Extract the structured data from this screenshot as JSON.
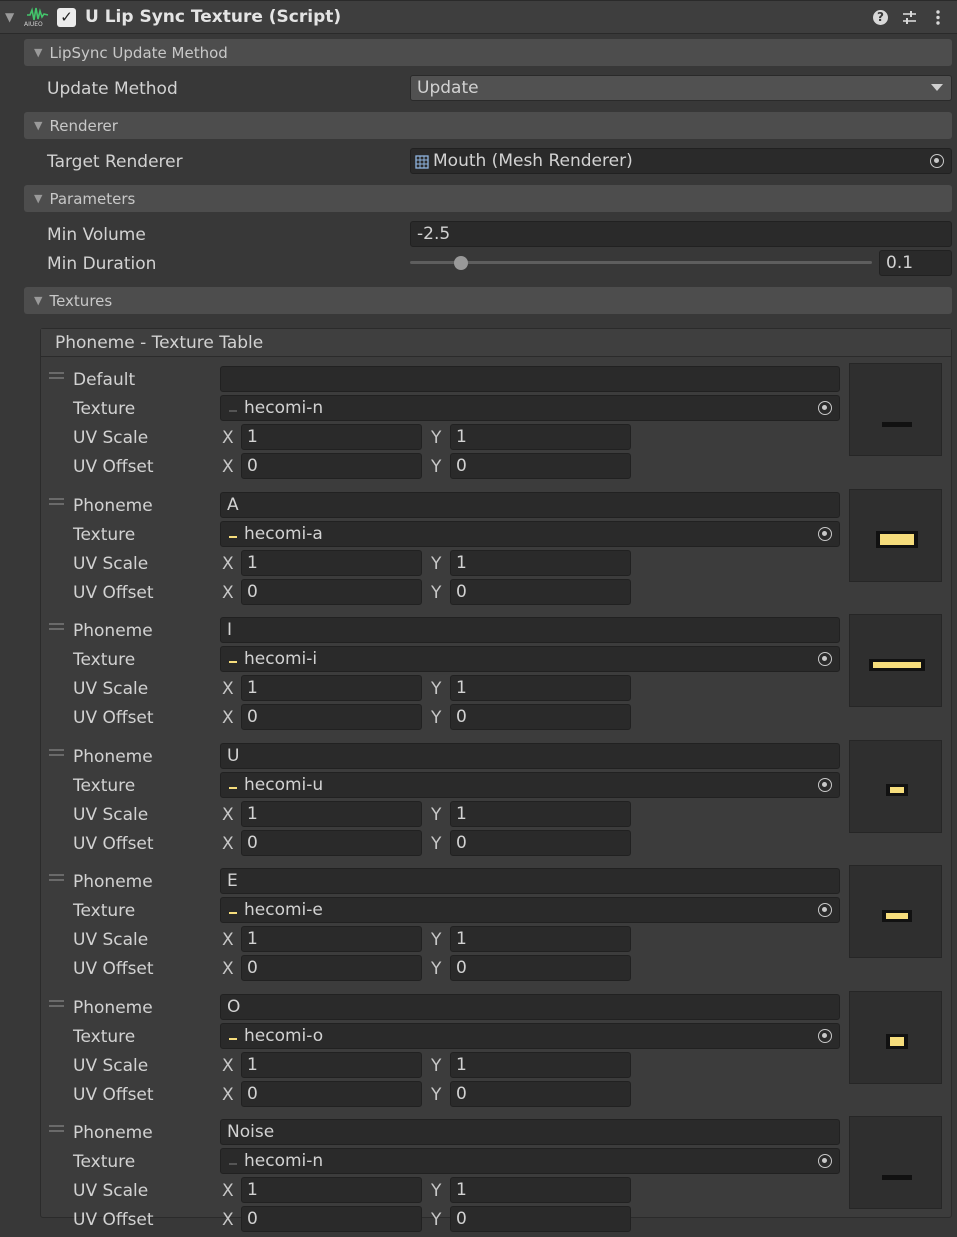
{
  "component": {
    "title": "U Lip Sync Texture (Script)",
    "enabled": true,
    "icon_text": "AIUEO"
  },
  "sections": {
    "update_method": {
      "title": "LipSync Update Method",
      "field_label": "Update Method",
      "value": "Update"
    },
    "renderer": {
      "title": "Renderer",
      "field_label": "Target Renderer",
      "value": "Mouth (Mesh Renderer)"
    },
    "parameters": {
      "title": "Parameters",
      "min_volume_label": "Min Volume",
      "min_volume": "-2.5",
      "min_duration_label": "Min Duration",
      "min_duration": "0.1",
      "min_duration_fraction": 0.11
    },
    "textures": {
      "title": "Textures",
      "table_title": "Phoneme - Texture Table"
    }
  },
  "row_labels": {
    "texture": "Texture",
    "uv_scale": "UV Scale",
    "uv_offset": "UV Offset",
    "x": "X",
    "y": "Y"
  },
  "entries": [
    {
      "label": "Default",
      "phoneme": "",
      "texture": "hecomi-n",
      "scale_x": "1",
      "scale_y": "1",
      "offset_x": "0",
      "offset_y": "0",
      "mouth": "n"
    },
    {
      "label": "Phoneme",
      "phoneme": "A",
      "texture": "hecomi-a",
      "scale_x": "1",
      "scale_y": "1",
      "offset_x": "0",
      "offset_y": "0",
      "mouth": "a"
    },
    {
      "label": "Phoneme",
      "phoneme": "I",
      "texture": "hecomi-i",
      "scale_x": "1",
      "scale_y": "1",
      "offset_x": "0",
      "offset_y": "0",
      "mouth": "i"
    },
    {
      "label": "Phoneme",
      "phoneme": "U",
      "texture": "hecomi-u",
      "scale_x": "1",
      "scale_y": "1",
      "offset_x": "0",
      "offset_y": "0",
      "mouth": "u"
    },
    {
      "label": "Phoneme",
      "phoneme": "E",
      "texture": "hecomi-e",
      "scale_x": "1",
      "scale_y": "1",
      "offset_x": "0",
      "offset_y": "0",
      "mouth": "e"
    },
    {
      "label": "Phoneme",
      "phoneme": "O",
      "texture": "hecomi-o",
      "scale_x": "1",
      "scale_y": "1",
      "offset_x": "0",
      "offset_y": "0",
      "mouth": "o"
    },
    {
      "label": "Phoneme",
      "phoneme": "Noise",
      "texture": "hecomi-n",
      "scale_x": "1",
      "scale_y": "1",
      "offset_x": "0",
      "offset_y": "0",
      "mouth": "n"
    }
  ],
  "icons": {
    "help": "help-icon",
    "presets": "presets-icon",
    "more": "kebab-menu-icon",
    "dropdown": "dropdown-arrow-icon",
    "object_picker": "object-picker-icon",
    "mesh_renderer": "mesh-renderer-icon"
  },
  "colors": {
    "background": "#383838",
    "field": "#2a2a2a",
    "section_header": "#4d4d4d",
    "mouth_fill": "#f6dd7c"
  }
}
